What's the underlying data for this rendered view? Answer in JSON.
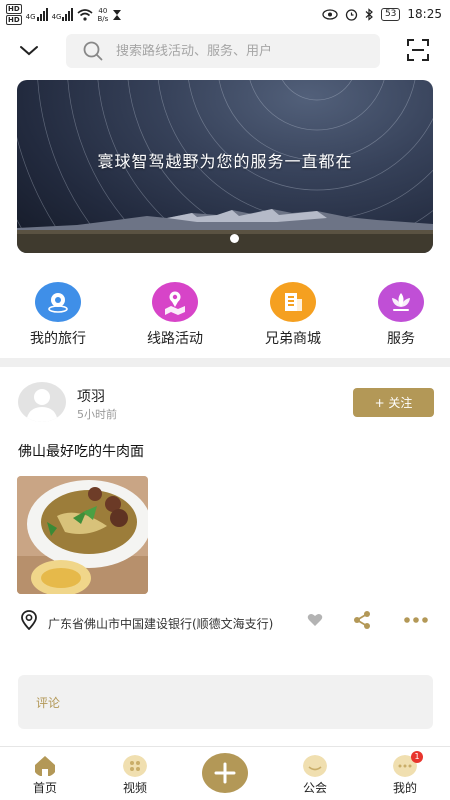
{
  "status_bar": {
    "net_speed_value": "40",
    "net_speed_unit": "B/s",
    "battery": "53",
    "time": "18:25"
  },
  "search": {
    "placeholder": "搜索路线活动、服务、用户"
  },
  "banner": {
    "text": "寰球智驾越野为您的服务一直都在"
  },
  "quick_links": [
    {
      "label": "我的旅行",
      "icon": "map-pin-icon",
      "color": "#3f8fe8"
    },
    {
      "label": "线路活动",
      "icon": "map-route-icon",
      "color": "#d744c8"
    },
    {
      "label": "兄弟商城",
      "icon": "shop-building-icon",
      "color": "#f5a020"
    },
    {
      "label": "服务",
      "icon": "lotus-icon",
      "color": "#c04fd6"
    }
  ],
  "post": {
    "username": "项羽",
    "time": "5小时前",
    "follow_label": "+ 关注",
    "title": "佛山最好吃的牛肉面",
    "location": "广东省佛山市中国建设银行(顺德文海支行)",
    "comment_label": "评论"
  },
  "tabbar": {
    "home": "首页",
    "video": "视频",
    "club": "公会",
    "mine": "我的",
    "mine_badge": "1"
  },
  "colors": {
    "accent_gold": "#b39857",
    "badge_red": "#e8352d"
  }
}
